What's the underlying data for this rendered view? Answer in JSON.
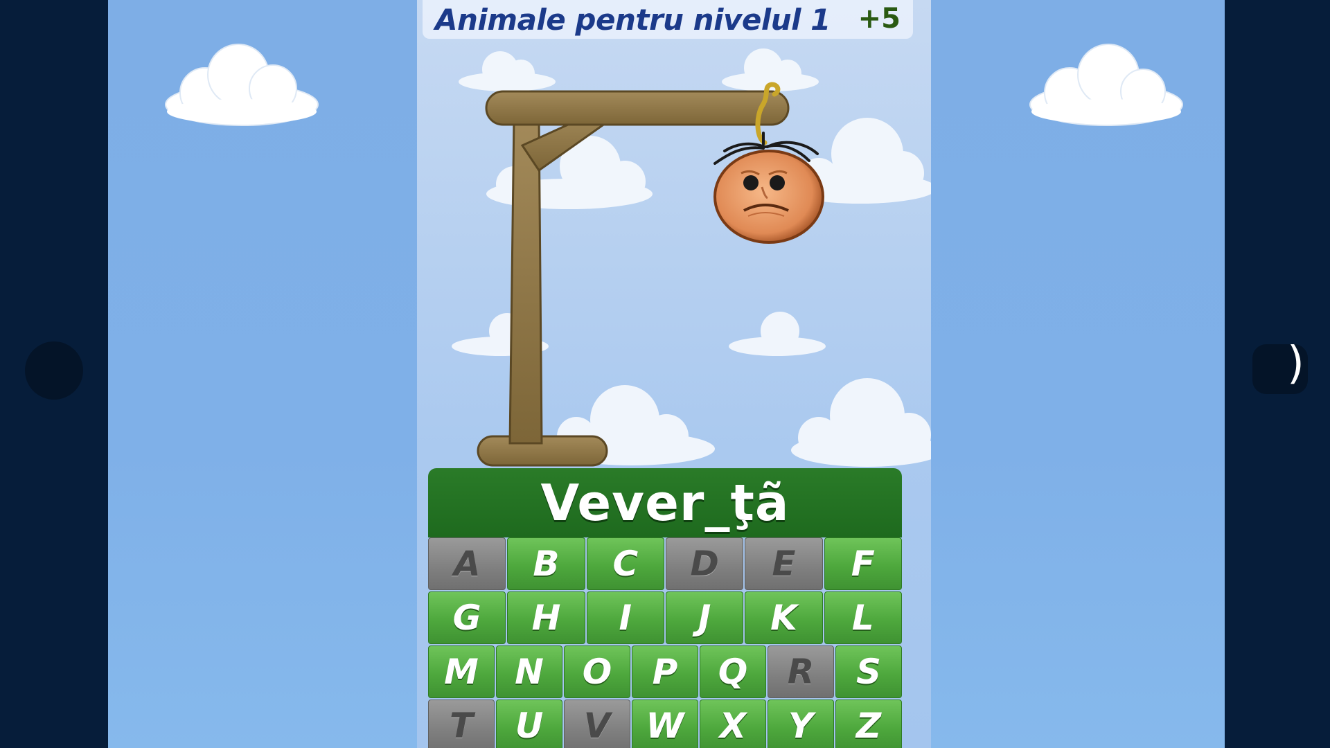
{
  "header": {
    "title": "Animale pentru nivelul 1",
    "score": "+5"
  },
  "word": {
    "display": "Vever_ţã"
  },
  "keyboard": {
    "rows": [
      [
        {
          "letter": "A",
          "used": true
        },
        {
          "letter": "B",
          "used": false
        },
        {
          "letter": "C",
          "used": false
        },
        {
          "letter": "D",
          "used": true
        },
        {
          "letter": "E",
          "used": true
        },
        {
          "letter": "F",
          "used": false
        }
      ],
      [
        {
          "letter": "G",
          "used": false
        },
        {
          "letter": "H",
          "used": false
        },
        {
          "letter": "I",
          "used": false
        },
        {
          "letter": "J",
          "used": false
        },
        {
          "letter": "K",
          "used": false
        },
        {
          "letter": "L",
          "used": false
        }
      ],
      [
        {
          "letter": "M",
          "used": false
        },
        {
          "letter": "N",
          "used": false
        },
        {
          "letter": "O",
          "used": false
        },
        {
          "letter": "P",
          "used": false
        },
        {
          "letter": "Q",
          "used": false
        },
        {
          "letter": "R",
          "used": true
        },
        {
          "letter": "S",
          "used": false
        }
      ],
      [
        {
          "letter": "T",
          "used": true
        },
        {
          "letter": "U",
          "used": false
        },
        {
          "letter": "V",
          "used": true
        },
        {
          "letter": "W",
          "used": false
        },
        {
          "letter": "X",
          "used": false
        },
        {
          "letter": "Y",
          "used": false
        },
        {
          "letter": "Z",
          "used": false
        }
      ]
    ]
  },
  "navigation": {
    "right_glyph": ")"
  },
  "colors": {
    "key_active": "#4ea83d",
    "key_used": "#7f7f7f",
    "word_panel": "#1e6a1e",
    "title_text": "#1b3a8a"
  }
}
